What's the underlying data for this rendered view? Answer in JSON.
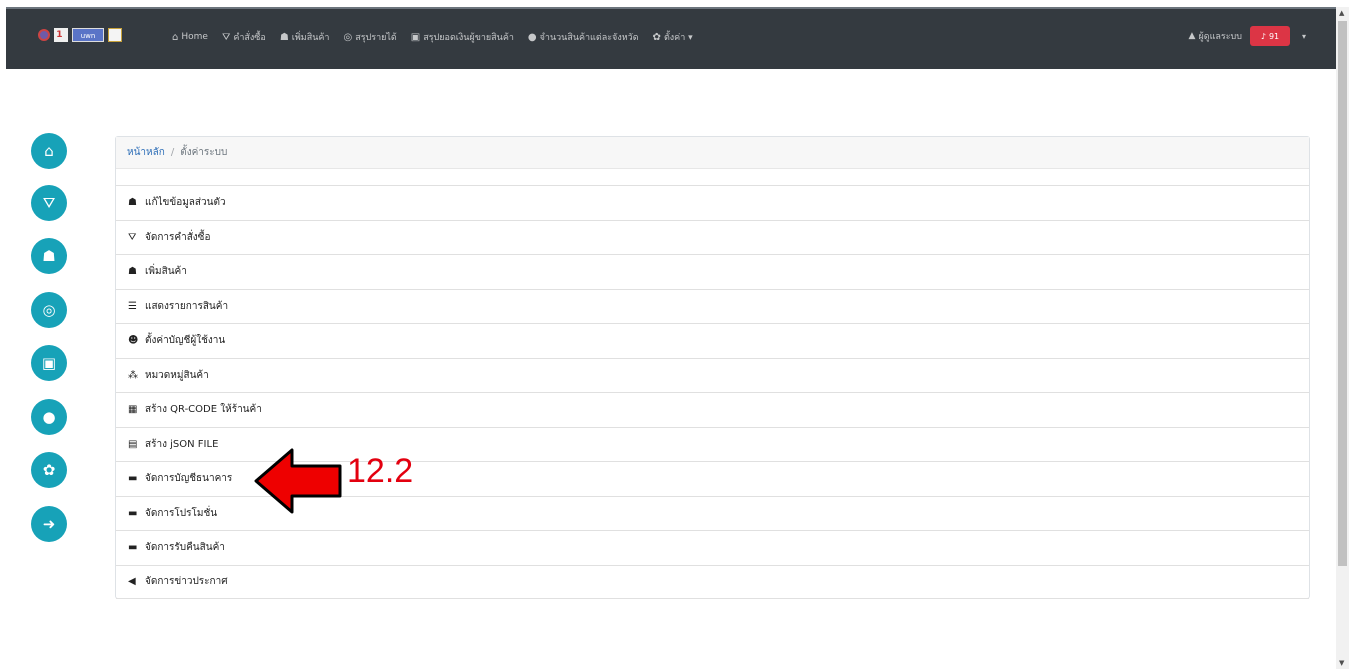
{
  "navbar": {
    "logo_text_1": "1 ",
    "logo_text_2": "uwn",
    "items": [
      {
        "icon": "⌂",
        "label": "Home"
      },
      {
        "icon": "⛛",
        "label": "คำสั่งซื้อ"
      },
      {
        "icon": "☗",
        "label": "เพิ่มสินค้า"
      },
      {
        "icon": "◎",
        "label": "สรุปรายได้"
      },
      {
        "icon": "▣",
        "label": "สรุปยอดเงินผู้ขายสินค้า"
      },
      {
        "icon": "●",
        "label": "จำนวนสินค้าแต่ละจังหวัด"
      },
      {
        "icon": "✿",
        "label": "ตั้งค่า ▾"
      }
    ],
    "user": {
      "icon": "▲",
      "name": "ผู้ดูแลระบบ"
    },
    "bell": {
      "icon": "♪",
      "count": "91"
    },
    "caret": "▾"
  },
  "sidebar": [
    {
      "name": "home",
      "icon": "⌂"
    },
    {
      "name": "cart",
      "icon": "⛛"
    },
    {
      "name": "bag",
      "icon": "☗"
    },
    {
      "name": "gem",
      "icon": "◎"
    },
    {
      "name": "money",
      "icon": "▣"
    },
    {
      "name": "location",
      "icon": "●"
    },
    {
      "name": "settings",
      "icon": "✿"
    },
    {
      "name": "logout",
      "icon": "➜"
    }
  ],
  "breadcrumb": {
    "home": "หน้าหลัก",
    "separator": "/",
    "current": "ตั้งค่าระบบ"
  },
  "menu": [
    {
      "icon": "☗",
      "label": "แก้ไขข้อมูลส่วนตัว"
    },
    {
      "icon": "⛛",
      "label": "จัดการคำสั่งซื้อ"
    },
    {
      "icon": "☗",
      "label": "เพิ่มสินค้า"
    },
    {
      "icon": "☰",
      "label": "แสดงรายการสินค้า"
    },
    {
      "icon": "☻",
      "label": "ตั้งค่าบัญชีผู้ใช้งาน"
    },
    {
      "icon": "⁂",
      "label": "หมวดหมู่สินค้า"
    },
    {
      "icon": "▦",
      "label": "สร้าง QR-CODE ให้ร้านค้า"
    },
    {
      "icon": "▤",
      "label": "สร้าง jSON FILE"
    },
    {
      "icon": "▬",
      "label": "จัดการบัญชีธนาคาร"
    },
    {
      "icon": "▬",
      "label": "จัดการโปรโมชั่น"
    },
    {
      "icon": "▬",
      "label": "จัดการรับคืนสินค้า"
    },
    {
      "icon": "◀",
      "label": "จัดการข่าวประกาศ"
    }
  ],
  "annotation": {
    "label": "12.2",
    "color": "#e3000f"
  },
  "colors": {
    "navbar": "#343a40",
    "accent": "#17a2b8",
    "badge": "#dc3545"
  }
}
